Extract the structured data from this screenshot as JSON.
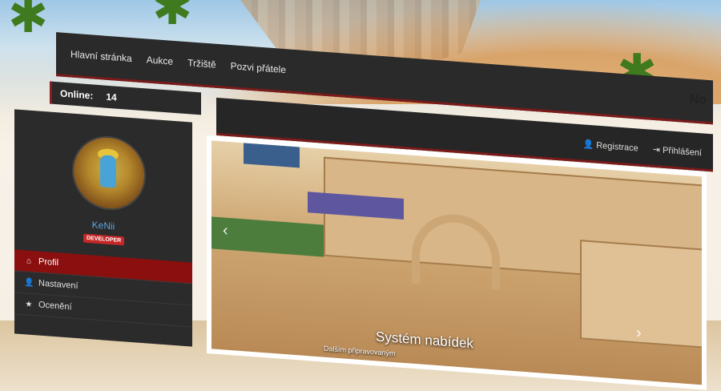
{
  "nav": {
    "items": [
      "Hlavní stránka",
      "Aukce",
      "Tržiště",
      "Pozvi přátele"
    ],
    "brand": "No"
  },
  "auth": {
    "register": "Registrace",
    "login": "Přihlášení"
  },
  "online": {
    "label": "Online:",
    "count": "14"
  },
  "profile": {
    "username": "KeNii",
    "badge": "DEVELOPER"
  },
  "sidebar": {
    "items": [
      {
        "label": "Profil",
        "icon": "home-icon",
        "active": true
      },
      {
        "label": "Nastavení",
        "icon": "user-icon",
        "active": false
      },
      {
        "label": "Ocenění",
        "icon": "star-icon",
        "active": false
      }
    ]
  },
  "slider": {
    "title": "Systém nabídek",
    "subtitle": "Dalším připravovaným"
  },
  "colors": {
    "nav_bg": "#2a2a2a",
    "accent_red": "#8b0f0f",
    "username_blue": "#5aa5e0",
    "badge_red": "#c62828"
  }
}
